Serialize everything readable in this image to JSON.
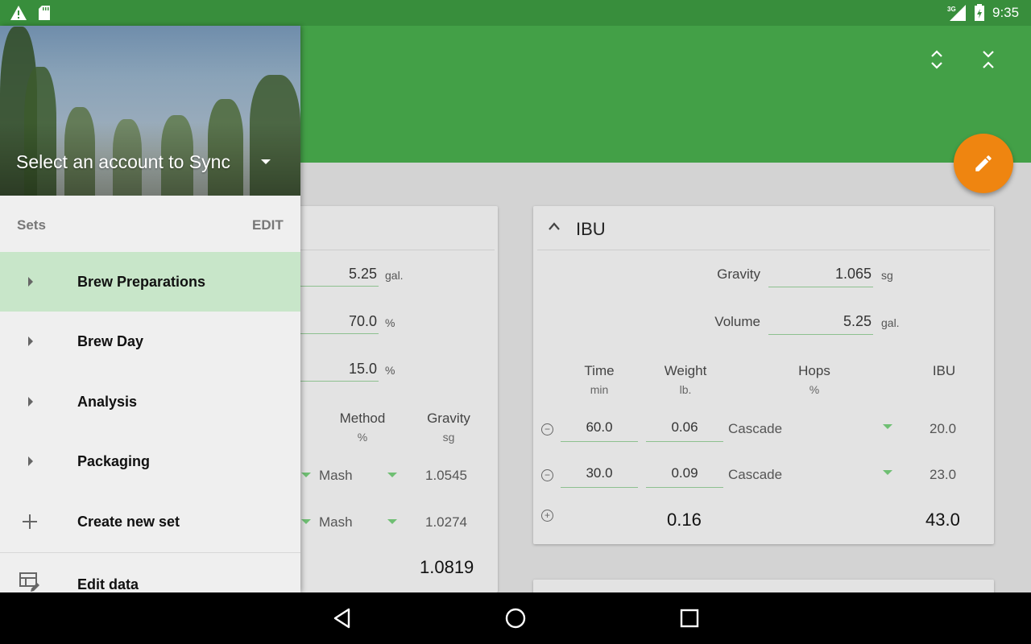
{
  "status_bar": {
    "time": "9:35",
    "network": "3G",
    "icons": [
      "warning-icon",
      "sd-card-icon",
      "signal-icon",
      "battery-icon"
    ]
  },
  "app_bar": {
    "color": "#43a047",
    "actions": [
      "expand-all-icon",
      "collapse-all-icon"
    ],
    "fab_icon": "edit-icon",
    "fab_color": "#ef8510"
  },
  "drawer": {
    "account_prompt": "Select an account to Sync",
    "sets_label": "Sets",
    "edit_label": "EDIT",
    "items": [
      {
        "label": "Brew Preparations",
        "icon": "chevron-right-icon",
        "active": true
      },
      {
        "label": "Brew Day",
        "icon": "chevron-right-icon",
        "active": false
      },
      {
        "label": "Analysis",
        "icon": "chevron-right-icon",
        "active": false
      },
      {
        "label": "Packaging",
        "icon": "chevron-right-icon",
        "active": false
      },
      {
        "label": "Create new set",
        "icon": "plus-icon",
        "active": false
      }
    ],
    "edit_data_label": "Edit data"
  },
  "left_card": {
    "volume": "5.25",
    "volume_unit": "gal.",
    "efficiency": "70.0",
    "efficiency_unit": "%",
    "third": "15.0",
    "third_unit": "%",
    "col_method": "Method",
    "col_method_sub": "%",
    "col_gravity": "Gravity",
    "col_gravity_sub": "sg",
    "rows": [
      {
        "method": "Mash",
        "gravity": "1.0545"
      },
      {
        "method": "Mash",
        "gravity": "1.0274"
      }
    ],
    "total_gravity": "1.0819"
  },
  "ibu_card": {
    "title": "IBU",
    "gravity_label": "Gravity",
    "gravity_value": "1.065",
    "gravity_unit": "sg",
    "volume_label": "Volume",
    "volume_value": "5.25",
    "volume_unit": "gal.",
    "headers": {
      "time": "Time",
      "time_sub": "min",
      "weight": "Weight",
      "weight_sub": "lb.",
      "hops": "Hops",
      "hops_sub": "%",
      "ibu": "IBU"
    },
    "rows": [
      {
        "time": "60.0",
        "weight": "0.06",
        "hops": "Cascade",
        "ibu": "20.0"
      },
      {
        "time": "30.0",
        "weight": "0.09",
        "hops": "Cascade",
        "ibu": "23.0"
      }
    ],
    "total_weight": "0.16",
    "total_ibu": "43.0"
  },
  "nav_bar": {
    "buttons": [
      "back-icon",
      "home-icon",
      "recents-icon"
    ]
  }
}
